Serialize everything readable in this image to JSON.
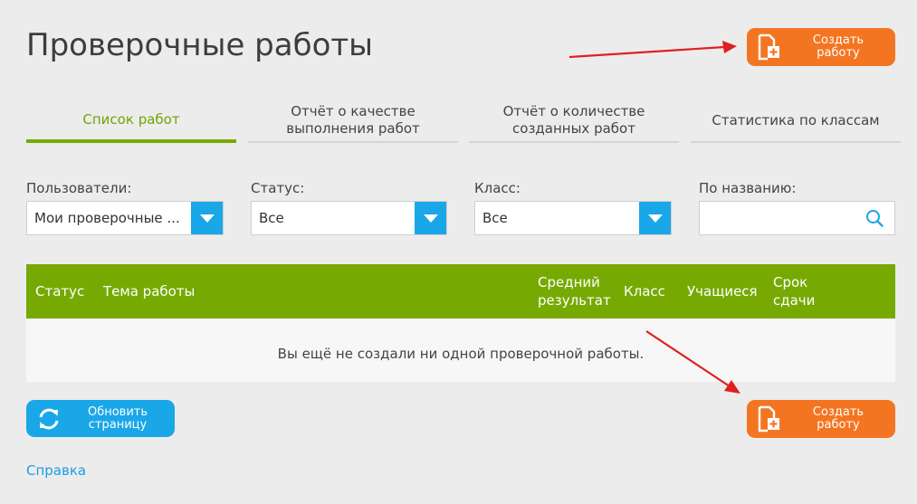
{
  "page": {
    "title": "Проверочные работы"
  },
  "buttons": {
    "create_top": "Создать\nработу",
    "create_bottom": "Создать\nработу",
    "refresh": "Обновить\nстраницу"
  },
  "tabs": [
    {
      "label": "Список работ",
      "active": true
    },
    {
      "label": "Отчёт о качестве\nвыполнения работ",
      "active": false
    },
    {
      "label": "Отчёт о количестве\nсозданных работ",
      "active": false
    },
    {
      "label": "Статистика по классам",
      "active": false
    }
  ],
  "filters": {
    "users": {
      "label": "Пользователи:",
      "value": "Мои проверочные ..."
    },
    "status": {
      "label": "Статус:",
      "value": "Все"
    },
    "class": {
      "label": "Класс:",
      "value": "Все"
    },
    "name": {
      "label": "По названию:",
      "placeholder": ""
    }
  },
  "table": {
    "columns": [
      "Статус",
      "Тема работы",
      "Средний\nрезультат",
      "Класс",
      "Учащиеся",
      "Срок\nсдачи"
    ],
    "empty_message": "Вы ещё не создали ни одной проверочной работы."
  },
  "footer": {
    "help_link": "Справка"
  },
  "colors": {
    "accent_green": "#76aa03",
    "orange": "#f47521",
    "blue": "#1aa7e8",
    "annotation_arrow": "#e02020"
  },
  "icons": {
    "create": "document-plus-icon",
    "refresh": "refresh-icon",
    "dropdown": "chevron-down-icon",
    "search": "search-icon"
  }
}
